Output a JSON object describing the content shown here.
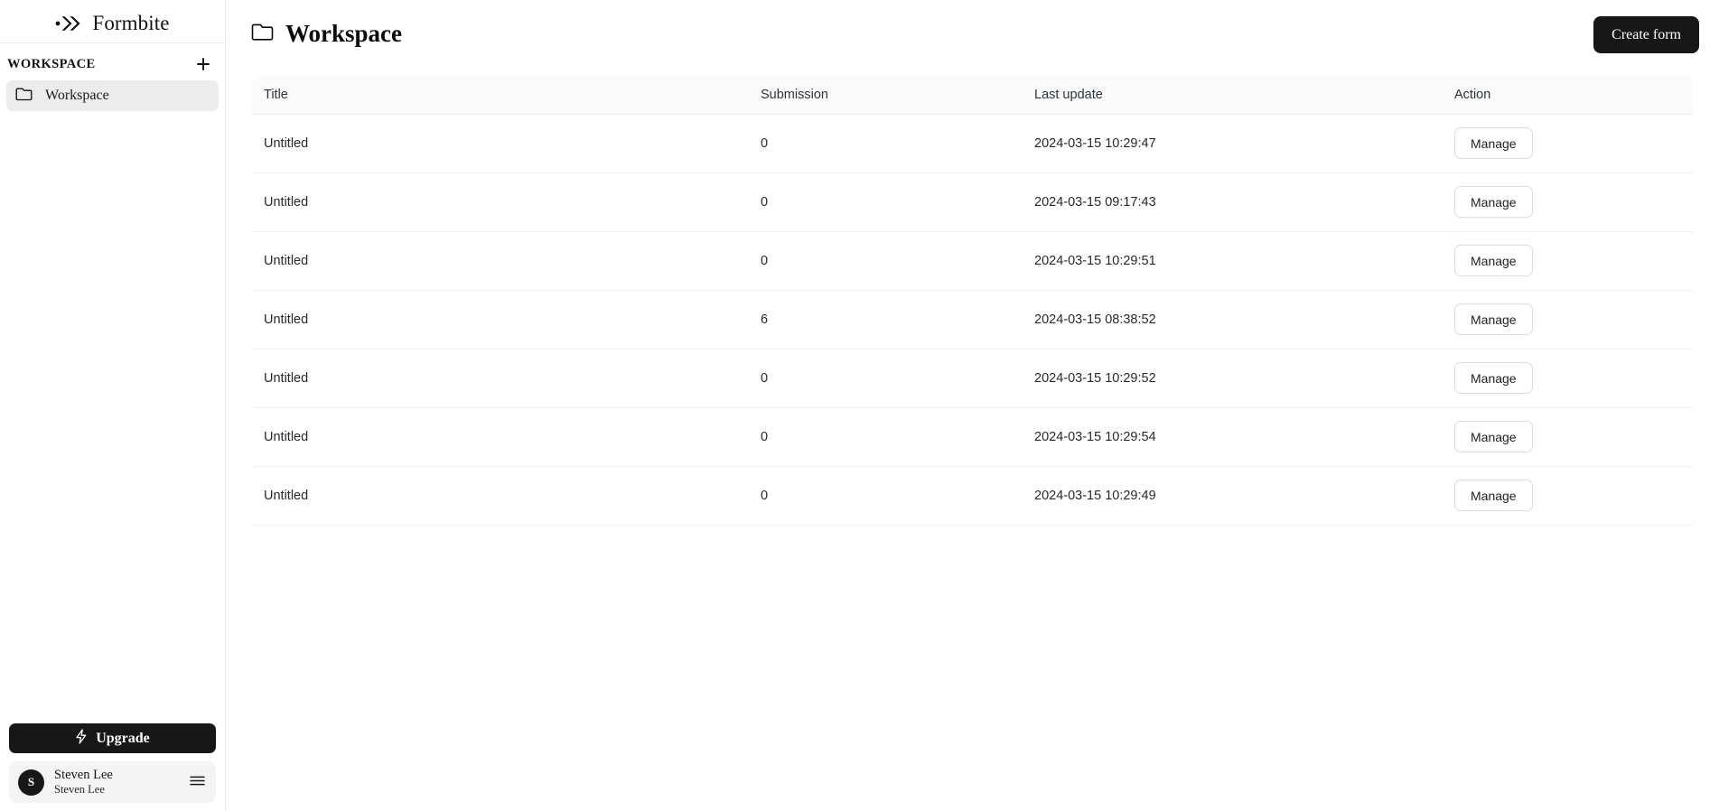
{
  "sidebar": {
    "brand": {
      "name": "Formbite",
      "logo_icon": "double-chevron-logo-icon"
    },
    "section": {
      "label": "WORKSPACE",
      "add_icon": "plus-icon",
      "add_title": "Add workspace"
    },
    "items": [
      {
        "label": "Workspace",
        "icon": "folder-icon"
      }
    ],
    "upgrade": {
      "label": "Upgrade",
      "icon": "lightning-bolt-icon"
    },
    "user": {
      "avatar_initial": "S",
      "name": "Steven Lee",
      "subtitle": "Steven Lee",
      "menu_icon": "hamburger-menu-icon"
    }
  },
  "main": {
    "page_title": "Workspace",
    "page_title_icon": "folder-icon",
    "create_button": "Create form",
    "table": {
      "columns": [
        "Title",
        "Submission",
        "Last update",
        "Action"
      ],
      "rows": [
        {
          "title": "Untitled",
          "submission": "0",
          "last_update": "2024-03-15 10:29:47",
          "action": "Manage"
        },
        {
          "title": "Untitled",
          "submission": "0",
          "last_update": "2024-03-15 09:17:43",
          "action": "Manage"
        },
        {
          "title": "Untitled",
          "submission": "0",
          "last_update": "2024-03-15 10:29:51",
          "action": "Manage"
        },
        {
          "title": "Untitled",
          "submission": "6",
          "last_update": "2024-03-15 08:38:52",
          "action": "Manage"
        },
        {
          "title": "Untitled",
          "submission": "0",
          "last_update": "2024-03-15 10:29:52",
          "action": "Manage"
        },
        {
          "title": "Untitled",
          "submission": "0",
          "last_update": "2024-03-15 10:29:54",
          "action": "Manage"
        },
        {
          "title": "Untitled",
          "submission": "0",
          "last_update": "2024-03-15 10:29:49",
          "action": "Manage"
        }
      ]
    }
  },
  "colors": {
    "accent_dark": "#171717",
    "sidebar_active": "#ececec",
    "table_header_bg": "#fafafa",
    "border": "#ededed"
  }
}
